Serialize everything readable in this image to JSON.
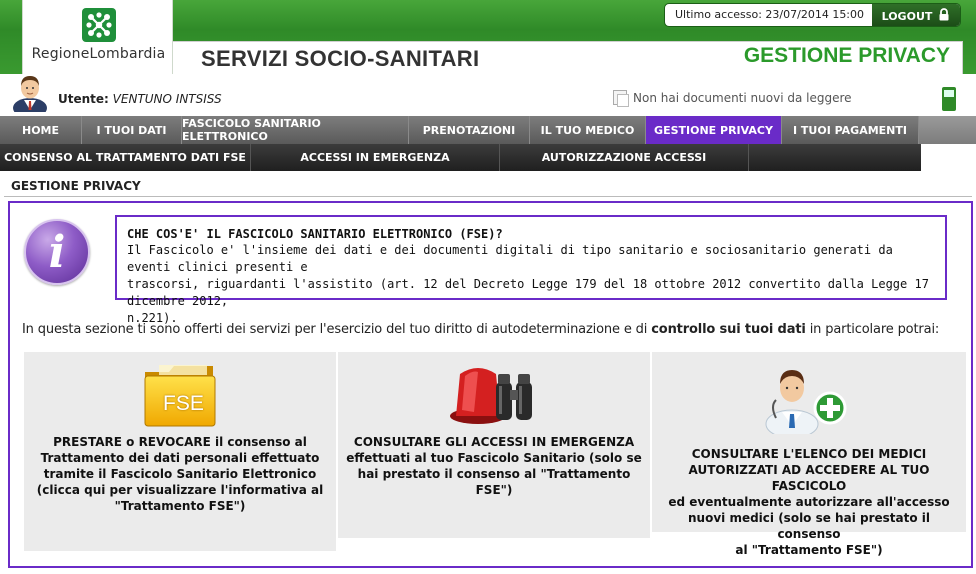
{
  "header": {
    "logo_text": "RegioneLombardia",
    "last_access": "Ultimo accesso: 23/07/2014 15:00",
    "logout_label": "LOGOUT",
    "service_title": "SERVIZI SOCIO-SANITARI",
    "section_title": "GESTIONE PRIVACY"
  },
  "user": {
    "label": "Utente:",
    "name": "VENTUNO INTSISS",
    "doc_notice": "Non hai documenti nuovi da leggere"
  },
  "nav": {
    "main": [
      {
        "label": "HOME"
      },
      {
        "label": "I TUOI DATI"
      },
      {
        "label": "FASCICOLO SANITARIO ELETTRONICO"
      },
      {
        "label": "PRENOTAZIONI"
      },
      {
        "label": "IL TUO MEDICO"
      },
      {
        "label": "GESTIONE PRIVACY"
      },
      {
        "label": "I TUOI PAGAMENTI"
      }
    ],
    "active_index": 5,
    "sub": [
      {
        "label": "CONSENSO AL TRATTAMENTO DATI FSE"
      },
      {
        "label": "ACCESSI IN EMERGENZA"
      },
      {
        "label": "AUTORIZZAZIONE ACCESSI"
      }
    ]
  },
  "page": {
    "title": "GESTIONE PRIVACY",
    "info_title": "CHE COS'E' IL FASCICOLO SANITARIO ELETTRONICO (FSE)?",
    "info_line1": "Il Fascicolo e' l'insieme dei dati e dei documenti digitali di tipo sanitario e sociosanitario generati da eventi clinici presenti e",
    "info_line2": "trascorsi, riguardanti l'assistito (art. 12 del Decreto Legge 179 del 18 ottobre 2012 convertito dalla Legge 17 dicembre 2012,",
    "info_line3": "n.221).",
    "intro_pre": "In questa sezione ti sono offerti dei servizi per l'esercizio del tuo diritto di autodeterminazione e di ",
    "intro_bold": "controllo sui tuoi dati",
    "intro_post": " in particolare potrai:"
  },
  "cards": [
    {
      "icon_label": "FSE",
      "line1": "PRESTARE o REVOCARE il consenso al",
      "line2": "Trattamento dei dati personali effettuato",
      "line3": "tramite il Fascicolo Sanitario Elettronico",
      "line4": "(clicca qui per visualizzare l'informativa al",
      "line5": "\"Trattamento FSE\")"
    },
    {
      "line1": "CONSULTARE GLI ACCESSI IN EMERGENZA",
      "line2": "effettuati al tuo Fascicolo Sanitario (solo se",
      "line3": "hai prestato il consenso al \"Trattamento FSE\")"
    },
    {
      "line1": "CONSULTARE L'ELENCO DEI MEDICI",
      "line2": "AUTORIZZATI AD ACCEDERE AL TUO FASCICOLO",
      "line3": "ed eventualmente autorizzare all'accesso",
      "line4": "nuovi medici (solo se hai prestato il consenso",
      "line5": "al \"Trattamento FSE\")"
    }
  ],
  "icons": {
    "logo": "regione-lombardia-logo",
    "lock": "lock-icon",
    "avatar": "user-avatar-icon",
    "document": "document-icon",
    "phone": "mobile-phone-icon",
    "info": "info-icon",
    "folder": "folder-icon",
    "siren": "siren-binoculars-icon",
    "doctor": "doctor-add-icon"
  },
  "colors": {
    "brand_green": "#2f8a28",
    "accent_purple": "#6a2bc8",
    "title_green": "#2b9a2b"
  }
}
